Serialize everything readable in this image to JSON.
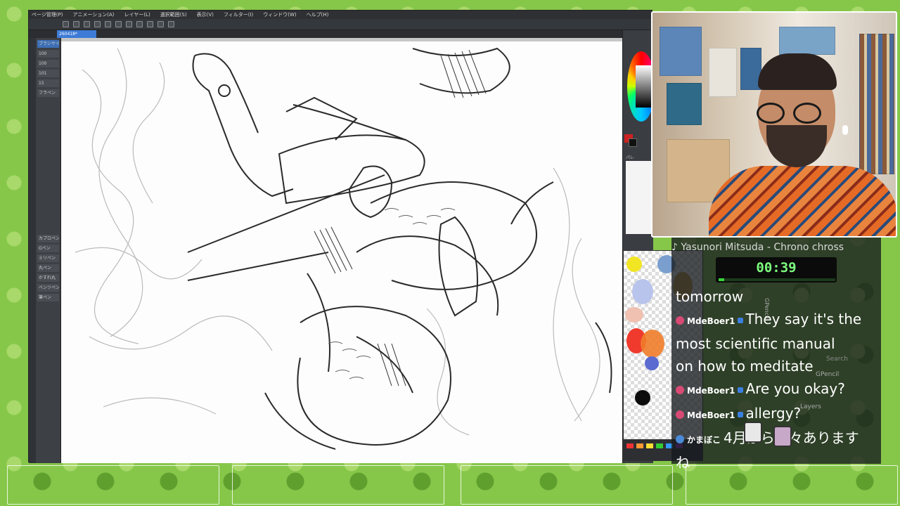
{
  "app": {
    "menu": [
      "ページ管理(P)",
      "アニメーション(A)",
      "レイヤー(L)",
      "選択範囲(S)",
      "表示(V)",
      "フィルター(I)",
      "ウィンドウ(W)",
      "ヘルプ(H)"
    ],
    "doc_tab": "260418*",
    "tool_props": [
      "ブラシサイズ",
      "100",
      "100",
      "101",
      "15",
      "フラペン"
    ],
    "subtools": [
      "カブロペン",
      "Gペン",
      "ミリペン",
      "丸ペン",
      "かすれ丸",
      "ベンツペン",
      "筆ペン"
    ],
    "palette_tab": "パレ"
  },
  "stream": {
    "now_playing": "♪ Yasunori Mitsuda - Chrono chross",
    "timer": "00:39",
    "timer_progress": 0.05,
    "chat": [
      {
        "user": "",
        "text": "tomorrow"
      },
      {
        "user": "MdeBoer1",
        "text": "They say it's the"
      },
      {
        "user": "",
        "text": "most scientific manual"
      },
      {
        "user": "",
        "text": "on how to meditate"
      },
      {
        "user": "MdeBoer1",
        "text": "Are you okay?"
      },
      {
        "user": "MdeBoer1",
        "text": "allergy?"
      },
      {
        "user": "かまぼこ",
        "text": "4月から色々あります"
      },
      {
        "user": "",
        "text": "ね"
      }
    ],
    "ghost": {
      "search": "Search",
      "gpencil": "GPencil",
      "layers": "Layers",
      "gpencil_vertical": "GPencil"
    }
  },
  "colors": {
    "accent_blue": "#3d6fb5",
    "timer_green": "#7dff7d",
    "bg_green": "#86c74a"
  },
  "icons": [
    "pen-icon",
    "eraser-icon",
    "undo-icon",
    "redo-icon",
    "save-icon"
  ]
}
